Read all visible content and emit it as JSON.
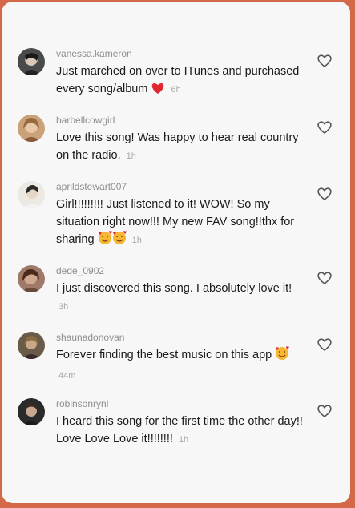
{
  "comments": [
    {
      "username": "vanessa.kameron",
      "text": "Just marched on over to ITunes and purchased every song/album",
      "emoji": "red-heart",
      "time": "6h",
      "avatar_color": "#3a3a3a"
    },
    {
      "username": "barbellcowgirl",
      "text": "Love this song! Was happy to hear real country on the radio.",
      "emoji": "",
      "time": "1h",
      "avatar_color": "#b08060"
    },
    {
      "username": "aprildstewart007",
      "text": "Girl!!!!!!!!! Just listened to it! WOW! So my situation right now!!! My new FAV song!!thx for sharing",
      "emoji": "smiling-face-with-hearts x2",
      "time": "1h",
      "avatar_color": "#e6e0d8"
    },
    {
      "username": "dede_0902",
      "text": "I just discovered this song. I absolutely love it!",
      "emoji": "",
      "time": "3h",
      "avatar_color": "#8a6a5a"
    },
    {
      "username": "shaunadonovan",
      "text": "Forever finding the best music on this app",
      "emoji": "smiling-face-with-hearts",
      "time": "44m",
      "avatar_color": "#5a4a3a"
    },
    {
      "username": "robinsonrynl",
      "text": "I heard this song for the first time the other day!! Love Love Love it!!!!!!!!",
      "emoji": "",
      "time": "1h",
      "avatar_color": "#2a2a2a"
    }
  ],
  "colors": {
    "frame": "#d4694a",
    "panel": "#f7f7f7",
    "username": "#8e8e8e",
    "text": "#1a1a1a",
    "heart_emoji": "#e0262f"
  }
}
